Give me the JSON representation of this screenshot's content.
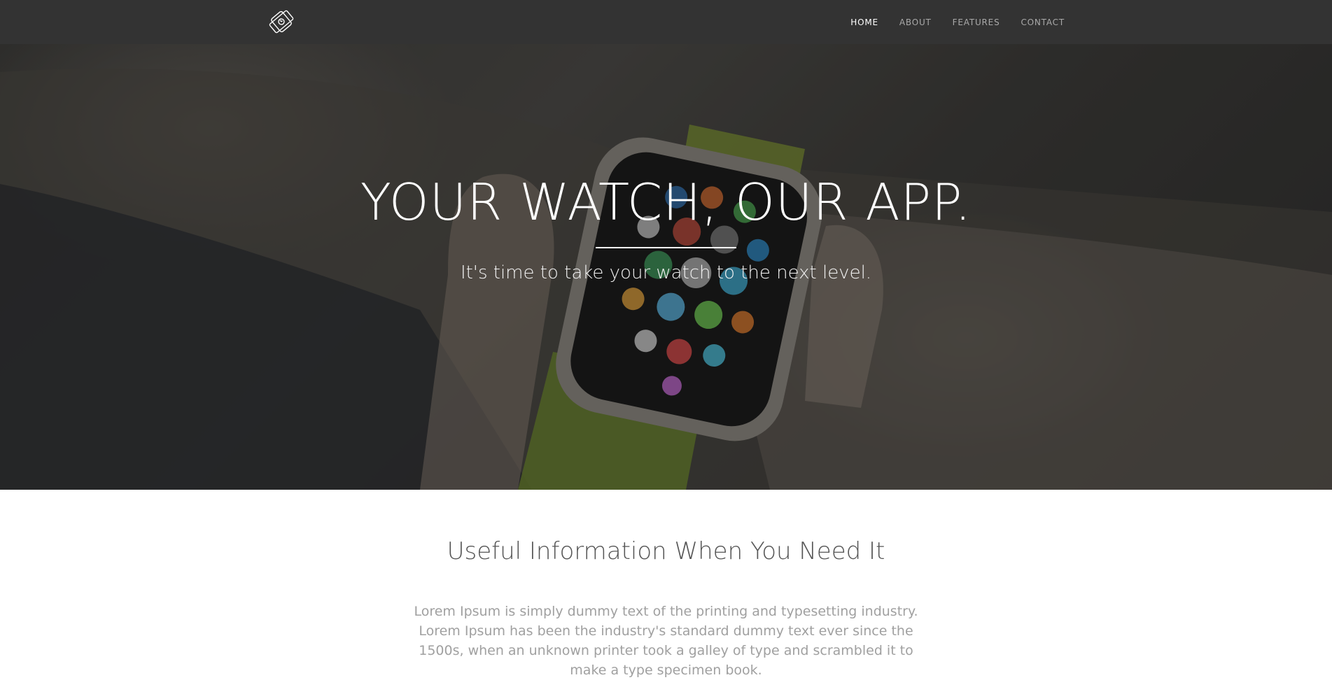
{
  "navbar": {
    "logo_icon": "smartwatch-icon",
    "items": [
      {
        "label": "HOME",
        "active": true
      },
      {
        "label": "ABOUT",
        "active": false
      },
      {
        "label": "FEATURES",
        "active": false
      },
      {
        "label": "CONTACT",
        "active": false
      }
    ]
  },
  "hero": {
    "title": "YOUR WATCH, OUR APP.",
    "subtitle": "It's time to take your watch to the next level."
  },
  "section": {
    "title": "Useful Information When You Need It",
    "body": "Lorem Ipsum is simply dummy text of the printing and typesetting industry. Lorem Ipsum has been the industry's standard dummy text ever since the 1500s, when an unknown printer took a galley of type and scrambled it to make a type specimen book."
  },
  "colors": {
    "navbar_bg": "#333333",
    "nav_active": "#ffffff",
    "nav_inactive": "#a9a9a9",
    "section_title": "#555555",
    "section_body": "#a0a0a0"
  }
}
